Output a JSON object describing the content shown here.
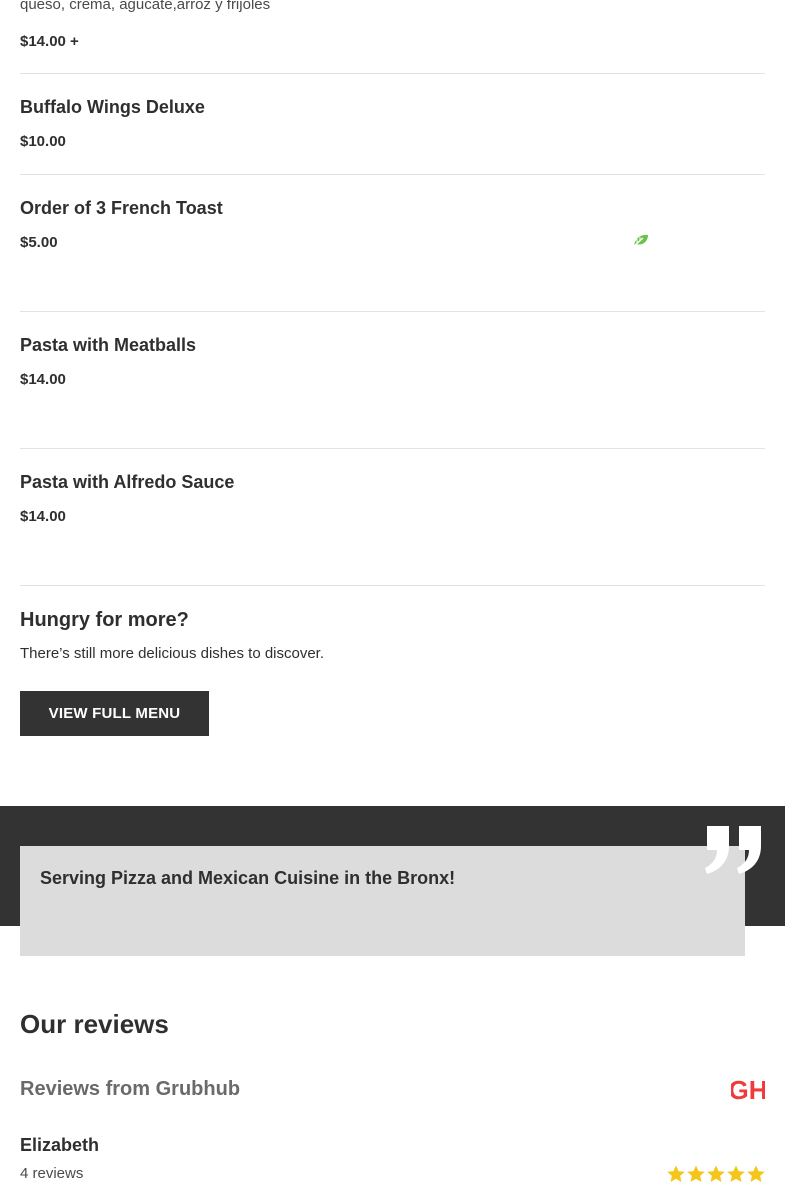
{
  "menu": {
    "partial_item": {
      "description": "queso, crema, agucate,arroz y frijoles",
      "price": "$14.00 +"
    },
    "items": [
      {
        "name": "Buffalo Wings Deluxe",
        "price": "$10.00"
      },
      {
        "name": "Order of 3 French Toast",
        "price": "$5.00",
        "icon": "vegetarian-leaf-icon"
      },
      {
        "name": "Pasta with Meatballs",
        "price": "$14.00"
      },
      {
        "name": "Pasta with Alfredo Sauce",
        "price": "$14.00"
      }
    ]
  },
  "more": {
    "title": "Hungry for more?",
    "subtitle": "There’s still more delicious dishes to discover.",
    "button_label": "VIEW FULL MENU"
  },
  "tagline": {
    "text": "Serving Pizza and Mexican Cuisine in the Bronx!",
    "icon": "quote-icon"
  },
  "reviews": {
    "title": "Our reviews",
    "source_label": "Reviews from Grubhub",
    "source_logo_text": "GH",
    "entries": [
      {
        "reviewer": "Elizabeth",
        "review_count": "4 reviews",
        "rating": 5
      }
    ]
  },
  "colors": {
    "accent_green": "#6cc24a",
    "grubhub_red": "#ef3b3b",
    "star_gold": "#f5c518",
    "dark": "#333333"
  }
}
